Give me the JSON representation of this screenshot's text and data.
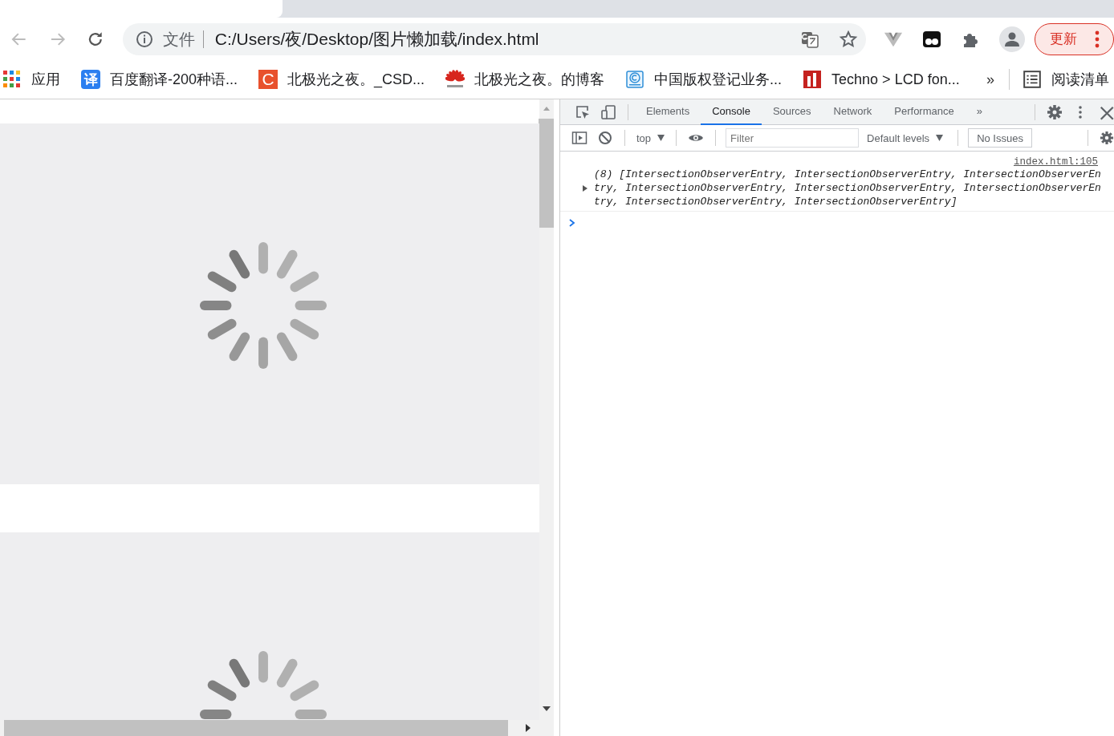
{
  "toolbar": {
    "url_scheme_label": "文件",
    "url": "C:/Users/夜/Desktop/图片懒加载/index.html",
    "update_button": "更新"
  },
  "bookmarks": [
    {
      "kind": "apps",
      "label": "应用"
    },
    {
      "kind": "translate",
      "icon_text": "译",
      "label": "百度翻译-200种语..."
    },
    {
      "kind": "letter",
      "icon_text": "C",
      "label": "北极光之夜。_CSD..."
    },
    {
      "kind": "flower",
      "label": "北极光之夜。的博客"
    },
    {
      "kind": "copyright",
      "label": "中国版权登记业务..."
    },
    {
      "kind": "techno",
      "label": "Techno > LCD fon..."
    }
  ],
  "bookmarks_more": "»",
  "reading_list": "阅读清单",
  "page": {
    "images": [
      {
        "kind": "spinner"
      },
      {
        "kind": "spinner"
      }
    ]
  },
  "devtools": {
    "tabs": [
      {
        "label": "Elements",
        "selected": false
      },
      {
        "label": "Console",
        "selected": true
      },
      {
        "label": "Sources",
        "selected": false
      },
      {
        "label": "Network",
        "selected": false
      },
      {
        "label": "Performance",
        "selected": false
      }
    ],
    "more_tabs": "»",
    "console_toolbar": {
      "context": "top",
      "filter_placeholder": "Filter",
      "levels": "Default levels",
      "issues": "No Issues"
    },
    "messages": [
      {
        "source": "index.html:105",
        "text": "(8) [IntersectionObserverEntry, IntersectionObserverEntry, IntersectionObserverEntry, IntersectionObserverEntry, IntersectionObserverEntry, IntersectionObserverEntry, IntersectionObserverEntry, IntersectionObserverEntry]",
        "expanded": false
      }
    ]
  }
}
